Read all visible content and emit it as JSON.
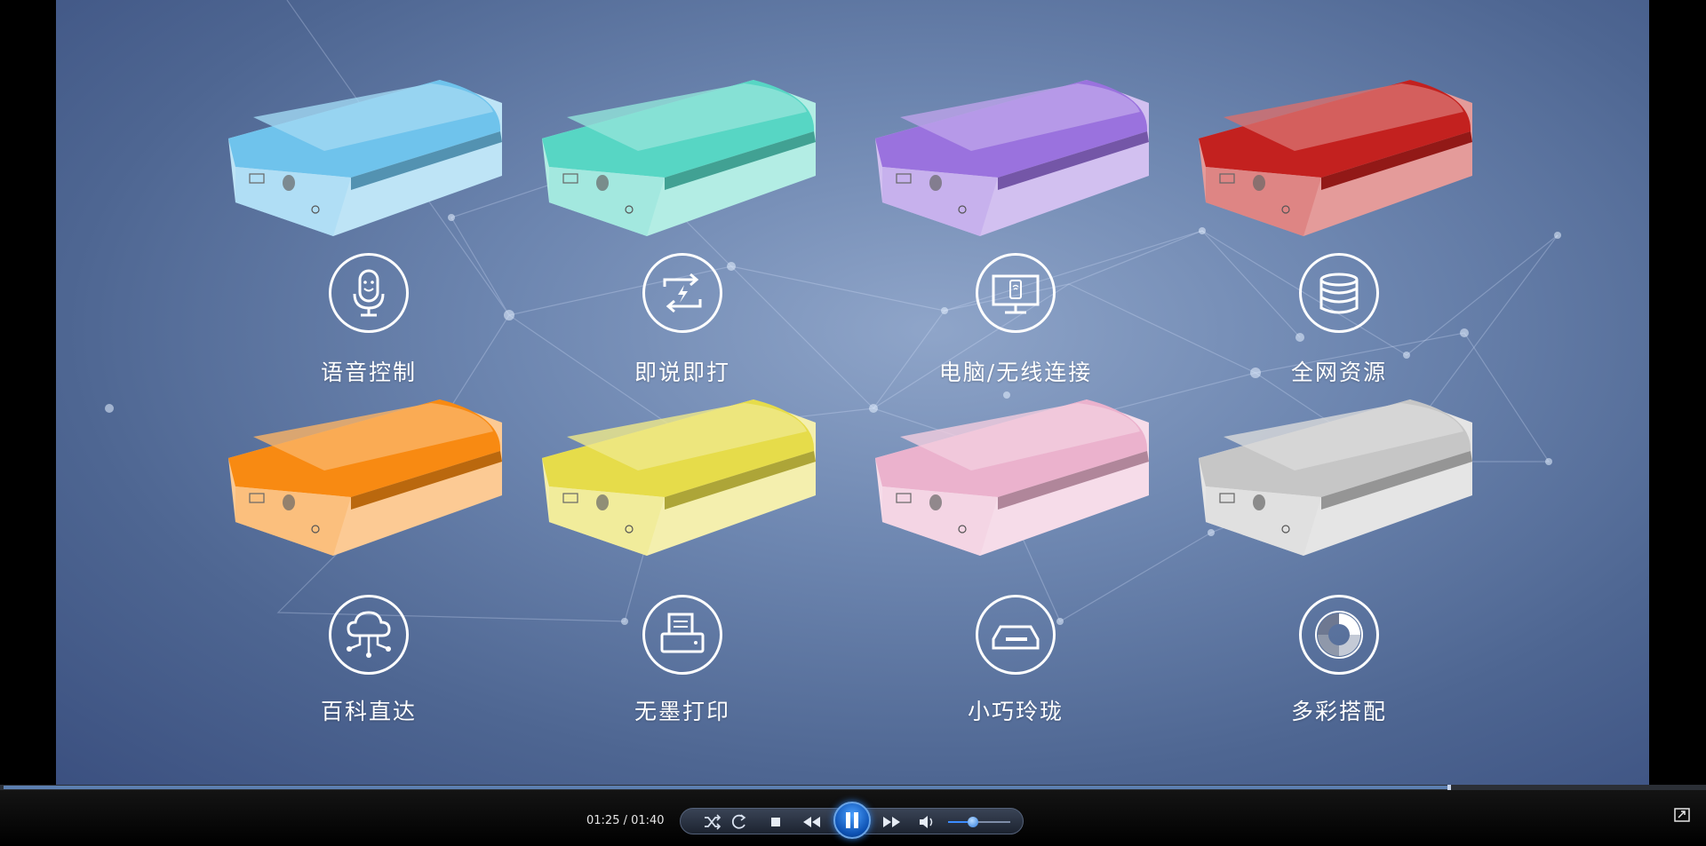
{
  "video": {
    "features": [
      {
        "label": "语音控制",
        "icon": "microphone-icon",
        "printer_color": "#6fc3ec"
      },
      {
        "label": "即说即打",
        "icon": "instant-print-icon",
        "printer_color": "#57d6c4"
      },
      {
        "label": "电脑/无线连接",
        "icon": "monitor-wireless-icon",
        "printer_color": "#9a72de"
      },
      {
        "label": "全网资源",
        "icon": "database-icon",
        "printer_color": "#c3211f"
      },
      {
        "label": "百科直达",
        "icon": "cloud-network-icon",
        "printer_color": "#f88a12"
      },
      {
        "label": "无墨打印",
        "icon": "printer-icon",
        "printer_color": "#e6dc4a"
      },
      {
        "label": "小巧玲珑",
        "icon": "compact-device-icon",
        "printer_color": "#ebb2cd"
      },
      {
        "label": "多彩搭配",
        "icon": "color-wheel-icon",
        "printer_color": "#c6c6c6"
      }
    ]
  },
  "player": {
    "time_display": "01:25 / 01:40",
    "progress": 0.85,
    "volume": 0.4,
    "controls": {
      "shuffle_icon": "shuffle-icon",
      "repeat_icon": "repeat-icon",
      "stop_icon": "stop-icon",
      "previous_icon": "rewind-icon",
      "play_pause_icon": "pause-icon",
      "next_icon": "fast-forward-icon",
      "volume_icon": "speaker-icon",
      "fullscreen_icon": "switch-to-compact-mode-icon"
    },
    "accent_color": "#2f7de0"
  }
}
